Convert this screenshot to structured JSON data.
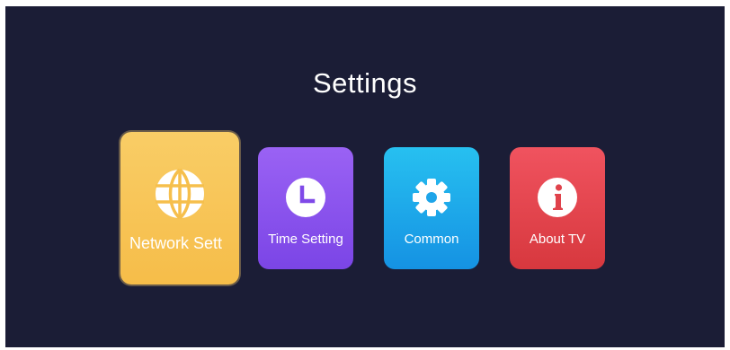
{
  "header": {
    "title": "Settings"
  },
  "menu": {
    "items": [
      {
        "label": "Network Sett",
        "icon": "globe-icon",
        "color": "#f7c453",
        "selected": true
      },
      {
        "label": "Time Setting",
        "icon": "clock-icon",
        "color": "#8a52ee",
        "selected": false
      },
      {
        "label": "Common",
        "icon": "gear-icon",
        "color": "#1eaaea",
        "selected": false
      },
      {
        "label": "About TV",
        "icon": "info-icon",
        "color": "#e5454e",
        "selected": false
      }
    ]
  },
  "colors": {
    "background": "#1b1d36"
  }
}
